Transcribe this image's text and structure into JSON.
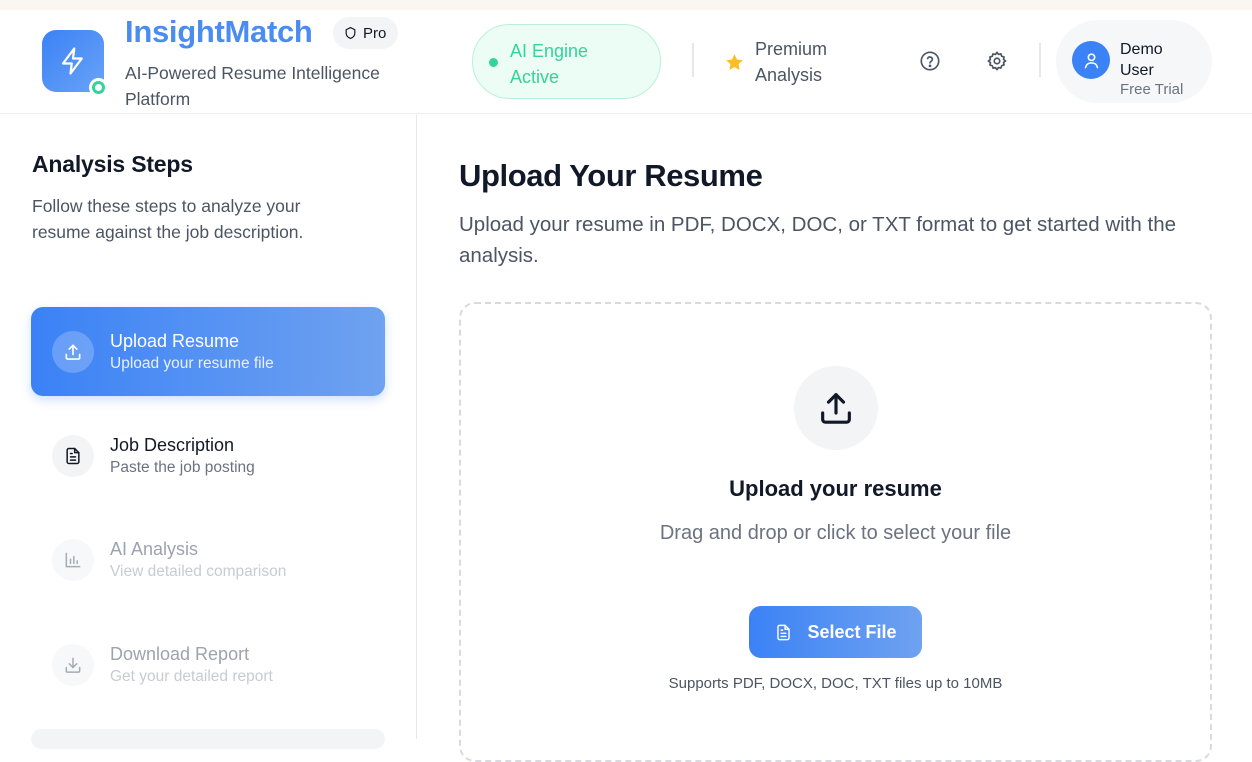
{
  "header": {
    "brand": "InsightMatch",
    "tier_badge": "Pro",
    "tagline": "AI-Powered Resume Intelligence Platform",
    "ai_status": "AI Engine Active",
    "premium": "Premium Analysis",
    "user": {
      "name": "Demo User",
      "plan": "Free Trial"
    }
  },
  "sidebar": {
    "title": "Analysis Steps",
    "description": "Follow these steps to analyze your resume against the job description.",
    "steps": [
      {
        "title": "Upload Resume",
        "subtitle": "Upload your resume file",
        "icon": "upload-icon",
        "state": "active"
      },
      {
        "title": "Job Description",
        "subtitle": "Paste the job posting",
        "icon": "document-icon",
        "state": "pending"
      },
      {
        "title": "AI Analysis",
        "subtitle": "View detailed comparison",
        "icon": "bar-chart-icon",
        "state": "disabled"
      },
      {
        "title": "Download Report",
        "subtitle": "Get your detailed report",
        "icon": "download-icon",
        "state": "disabled"
      }
    ]
  },
  "main": {
    "title": "Upload Your Resume",
    "description": "Upload your resume in PDF, DOCX, DOC, or TXT format to get started with the analysis.",
    "dropzone": {
      "title": "Upload your resume",
      "subtitle": "Drag and drop or click to select your file",
      "button_label": "Select File",
      "note": "Supports PDF, DOCX, DOC, TXT files up to 10MB"
    }
  },
  "colors": {
    "accent": "#3b82f6",
    "success": "#34d399",
    "star": "#fbbf24"
  }
}
